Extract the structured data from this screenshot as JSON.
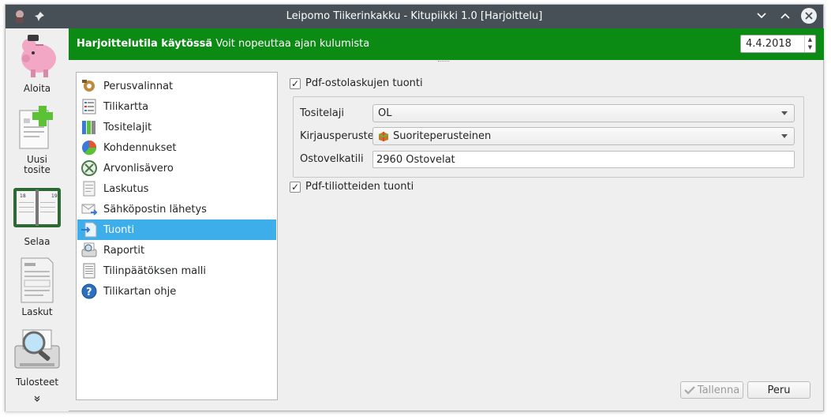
{
  "window": {
    "title": "Leipomo Tiikerinkakku - Kitupiikki 1.0 [Harjoittelu]"
  },
  "sidebar": {
    "items": [
      {
        "label": "Aloita",
        "icon": "piggy-bank-icon"
      },
      {
        "label": "Uusi\ntosite",
        "icon": "new-document-icon"
      },
      {
        "label": "Selaa",
        "icon": "calendar-book-icon"
      },
      {
        "label": "Laskut",
        "icon": "invoice-icon"
      },
      {
        "label": "Tulosteet",
        "icon": "print-preview-icon"
      }
    ],
    "more_icon": "double-chevron-down-icon"
  },
  "banner": {
    "bold_text": "Harjoittelutila käytössä",
    "text": "Voit nopeuttaa ajan kulumista",
    "date": "4.4.2018"
  },
  "menu": {
    "items": [
      {
        "label": "Perusvalinnat",
        "icon": "gear-icon"
      },
      {
        "label": "Tilikartta",
        "icon": "list-icon"
      },
      {
        "label": "Tositelajit",
        "icon": "binders-icon"
      },
      {
        "label": "Kohdennukset",
        "icon": "pie-chart-icon"
      },
      {
        "label": "Arvonlisävero",
        "icon": "tax-icon"
      },
      {
        "label": "Laskutus",
        "icon": "bill-icon"
      },
      {
        "label": "Sähköpostin lähetys",
        "icon": "email-send-icon"
      },
      {
        "label": "Tuonti",
        "icon": "import-icon"
      },
      {
        "label": "Raportit",
        "icon": "report-icon"
      },
      {
        "label": "Tilinpäätöksen malli",
        "icon": "document-template-icon"
      },
      {
        "label": "Tilikartan ohje",
        "icon": "help-icon"
      }
    ],
    "active_index": 7
  },
  "content": {
    "pdf_invoices": {
      "label": "Pdf-ostolaskujen tuonti",
      "checked": true
    },
    "tositelaji": {
      "label": "Tositelaji",
      "value": "OL"
    },
    "kirjausperuste": {
      "label": "Kirjausperuste",
      "value": "Suoriteperusteinen"
    },
    "ostovelkatili": {
      "label": "Ostovelkatili",
      "value": "2960 Ostovelat"
    },
    "pdf_statements": {
      "label": "Pdf-tiliotteiden tuonti",
      "checked": true
    }
  },
  "buttons": {
    "save_label": "Tallenna",
    "cancel_label": "Peru"
  },
  "colors": {
    "titlebar": "#475057",
    "banner": "#0b8a14",
    "selection": "#3daee9"
  }
}
